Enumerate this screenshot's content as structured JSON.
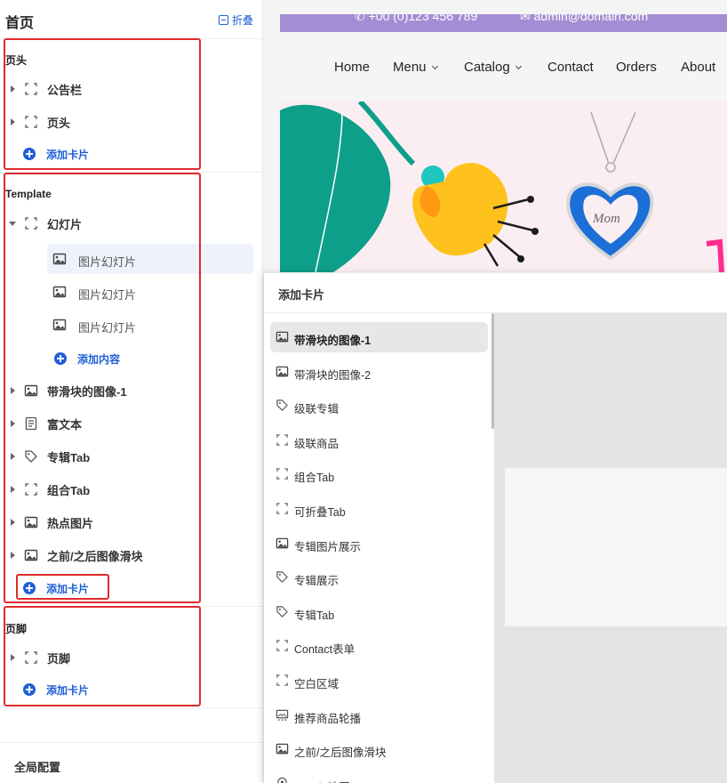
{
  "sidebar": {
    "title": "首页",
    "collapse_label": "折叠",
    "header_section": {
      "label": "页头",
      "items": [
        {
          "label": "公告栏",
          "icon": "dashed-square-icon"
        },
        {
          "label": "页头",
          "icon": "dashed-square-icon"
        }
      ],
      "add_label": "添加卡片"
    },
    "template_section": {
      "label": "Template",
      "slideshow": {
        "label": "幻灯片",
        "icon": "dashed-square-icon",
        "children": [
          {
            "label": "图片幻灯片",
            "icon": "image-icon"
          },
          {
            "label": "图片幻灯片",
            "icon": "image-icon"
          },
          {
            "label": "图片幻灯片",
            "icon": "image-icon"
          }
        ],
        "add_content_label": "添加内容"
      },
      "items": [
        {
          "label": "带滑块的图像-1",
          "icon": "image-icon"
        },
        {
          "label": "富文本",
          "icon": "document-icon"
        },
        {
          "label": "专辑Tab",
          "icon": "tag-icon"
        },
        {
          "label": "组合Tab",
          "icon": "dashed-square-icon"
        },
        {
          "label": "热点图片",
          "icon": "image-icon"
        },
        {
          "label": "之前/之后图像滑块",
          "icon": "image-icon"
        }
      ],
      "add_label": "添加卡片"
    },
    "footer_section": {
      "label": "页脚",
      "items": [
        {
          "label": "页脚",
          "icon": "dashed-square-icon"
        }
      ],
      "add_label": "添加卡片"
    },
    "global_config_label": "全局配置"
  },
  "preview": {
    "topbar": {
      "phone": "+00 (0)123 456 789",
      "email": "admin@domain.com"
    },
    "nav": {
      "items": [
        {
          "label": "Home",
          "dropdown": false
        },
        {
          "label": "Menu",
          "dropdown": true
        },
        {
          "label": "Catalog",
          "dropdown": true
        },
        {
          "label": "Contact",
          "dropdown": false
        },
        {
          "label": "Orders",
          "dropdown": false
        },
        {
          "label": "About",
          "dropdown": false
        }
      ]
    },
    "hero": {
      "pendant_text": "Mom"
    }
  },
  "popup": {
    "title": "添加卡片",
    "cards": [
      {
        "label": "带滑块的图像-1",
        "icon": "image-icon"
      },
      {
        "label": "带滑块的图像-2",
        "icon": "image-icon"
      },
      {
        "label": "级联专辑",
        "icon": "tag-icon"
      },
      {
        "label": "级联商品",
        "icon": "dashed-square-icon"
      },
      {
        "label": "组合Tab",
        "icon": "dashed-square-icon"
      },
      {
        "label": "可折叠Tab",
        "icon": "dashed-square-icon"
      },
      {
        "label": "专辑图片展示",
        "icon": "image-icon"
      },
      {
        "label": "专辑展示",
        "icon": "tag-icon"
      },
      {
        "label": "专辑Tab",
        "icon": "tag-icon"
      },
      {
        "label": "Contact表单",
        "icon": "dashed-square-icon"
      },
      {
        "label": "空白区域",
        "icon": "dashed-square-icon"
      },
      {
        "label": "推荐商品轮播",
        "icon": "carousel-icon"
      },
      {
        "label": "之前/之后图像滑块",
        "icon": "image-icon"
      },
      {
        "label": "google地图",
        "icon": "map-pin-icon"
      }
    ],
    "selected_index": 0
  },
  "colors": {
    "accent": "#1f5fd6",
    "highlight_box": "#e02a2a",
    "topbar": "#a58dd3",
    "hero_bg": "#fbeef2"
  }
}
